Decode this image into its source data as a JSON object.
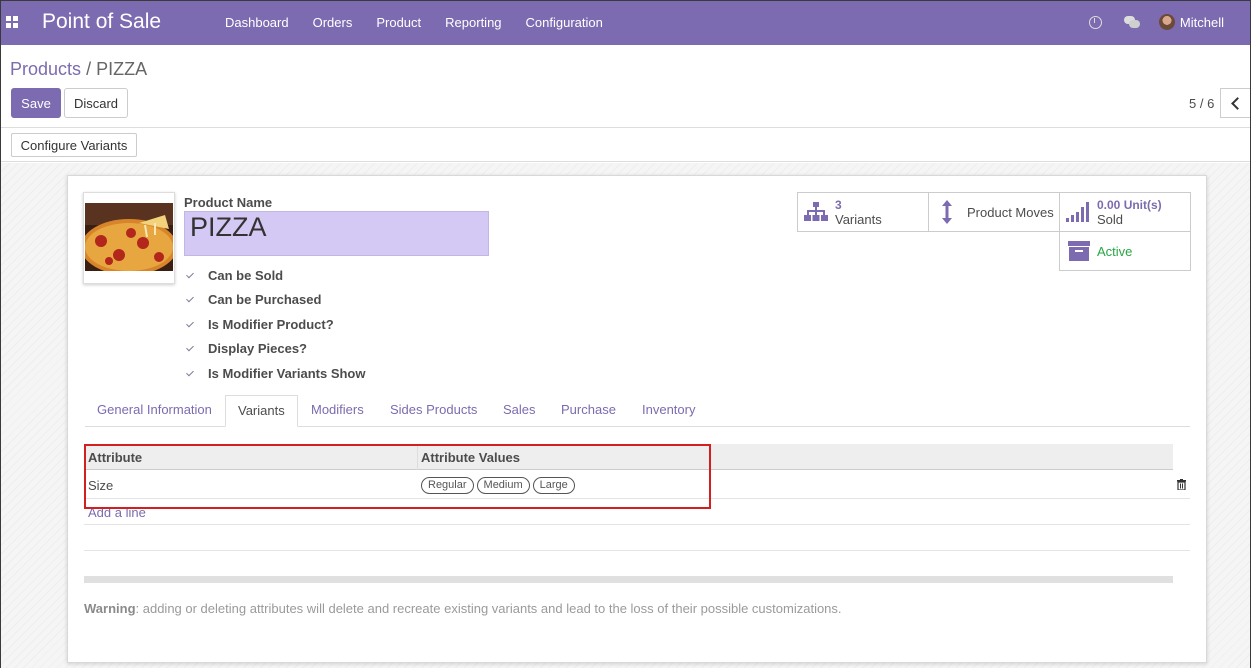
{
  "app": {
    "title": "Point of Sale",
    "menu": [
      "Dashboard",
      "Orders",
      "Product",
      "Reporting",
      "Configuration"
    ],
    "user": "Mitchell"
  },
  "breadcrumb": {
    "parent": "Products",
    "separator": "/",
    "current": "PIZZA"
  },
  "actions": {
    "save": "Save",
    "discard": "Discard",
    "configure_variants": "Configure Variants"
  },
  "pager": {
    "value": "5 / 6"
  },
  "product": {
    "name_label": "Product Name",
    "name": "PIZZA",
    "checkboxes": [
      {
        "label": "Can be Sold",
        "checked": true
      },
      {
        "label": "Can be Purchased",
        "checked": true
      },
      {
        "label": "Is Modifier Product?",
        "checked": true
      },
      {
        "label": "Display Pieces?",
        "checked": true
      },
      {
        "label": "Is Modifier Variants Show",
        "checked": true
      }
    ]
  },
  "smart_buttons": {
    "variants_count": "3",
    "variants_label": "Variants",
    "moves_label": "Product Moves",
    "sold_value": "0.00 Unit(s)",
    "sold_label": "Sold",
    "active_label": "Active"
  },
  "tabs": [
    "General Information",
    "Variants",
    "Modifiers",
    "Sides Products",
    "Sales",
    "Purchase",
    "Inventory"
  ],
  "active_tab": "Variants",
  "table": {
    "headers": [
      "Attribute",
      "Attribute Values"
    ],
    "rows": [
      {
        "attribute": "Size",
        "values": [
          "Regular",
          "Medium",
          "Large"
        ]
      }
    ],
    "add_line": "Add a line"
  },
  "warning": {
    "title": "Warning",
    "text": ": adding or deleting attributes will delete and recreate existing variants and lead to the loss of their possible customizations."
  },
  "colors": {
    "brand": "#7c6bb0",
    "active_status": "#28a745",
    "highlight": "#d21f1f"
  },
  "icons": [
    "apps-icon",
    "clock-icon",
    "chat-icon",
    "sitemap-icon",
    "arrows-vertical-icon",
    "signal-bars-icon",
    "archive-icon",
    "trash-icon",
    "chevron-left-icon"
  ]
}
